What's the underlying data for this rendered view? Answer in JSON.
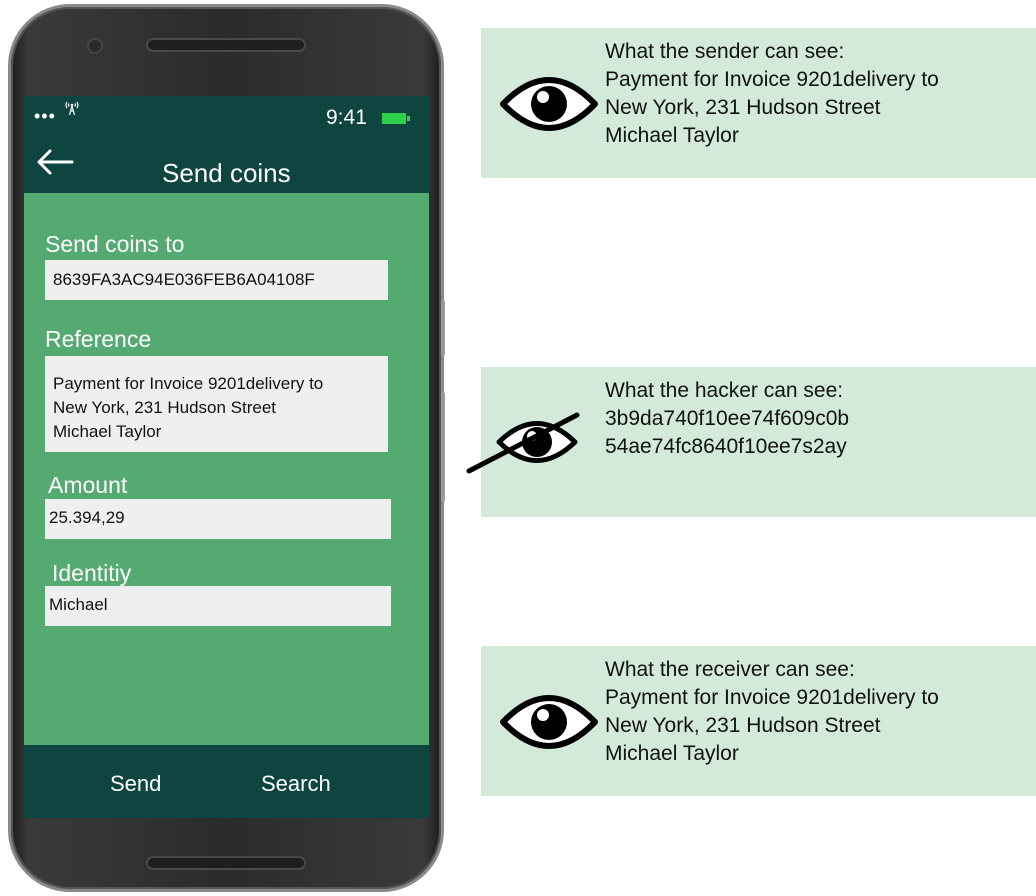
{
  "status_bar": {
    "dots": "•••",
    "time": "9:41",
    "icons": [
      "signal-icon",
      "battery-icon"
    ]
  },
  "header": {
    "title": "Send coins",
    "back_icon": "arrow-left-icon"
  },
  "form": {
    "send_to": {
      "label": "Send coins to",
      "value": "8639FA3AC94E036FEB6A04108F"
    },
    "reference": {
      "label": "Reference",
      "value": "Payment for Invoice 9201delivery to\nNew York, 231 Hudson Street\nMichael Taylor"
    },
    "amount": {
      "label": "Amount",
      "value": "25.394,29"
    },
    "identity": {
      "label": "Identitiy",
      "value": "Michael"
    }
  },
  "bottom_bar": {
    "send_label": "Send",
    "search_label": "Search"
  },
  "panels": {
    "sender": {
      "heading": "What the sender can see:",
      "lines": "Payment for Invoice 9201delivery to\nNew York, 231 Hudson Street\nMichael Taylor",
      "icon": "eye-icon"
    },
    "hacker": {
      "heading": "What the hacker can see:",
      "lines": "3b9da740f10ee74f609c0b\n54ae74fc8640f10ee7s2ay",
      "icon": "eye-crossed-icon"
    },
    "receiver": {
      "heading": "What the receiver can see:",
      "lines": "Payment for Invoice 9201delivery to\nNew York, 231 Hudson Street\nMichael Taylor",
      "icon": "eye-icon"
    }
  },
  "colors": {
    "bar": "#0f4540",
    "screen": "#55aa72",
    "panel": "#d3e9da",
    "field": "#edf0ef"
  }
}
